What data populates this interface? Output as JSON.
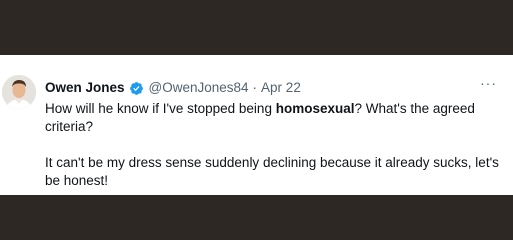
{
  "tweet": {
    "author_name": "Owen Jones",
    "verified_icon": "verified-badge-icon",
    "handle": "@OwenJones84",
    "separator": "·",
    "date": "Apr 22",
    "more_icon": "···",
    "paragraph1_before": "How will he know if I've stopped being ",
    "paragraph1_bold": "homosexual",
    "paragraph1_after": "? What's the agreed criteria?",
    "paragraph2": "It can't be my dress sense suddenly declining because it already sucks, let's be honest!"
  },
  "colors": {
    "background": "#2e2825",
    "card": "#ffffff",
    "text": "#0f1419",
    "secondary": "#536471",
    "verified": "#1d9bf0"
  }
}
